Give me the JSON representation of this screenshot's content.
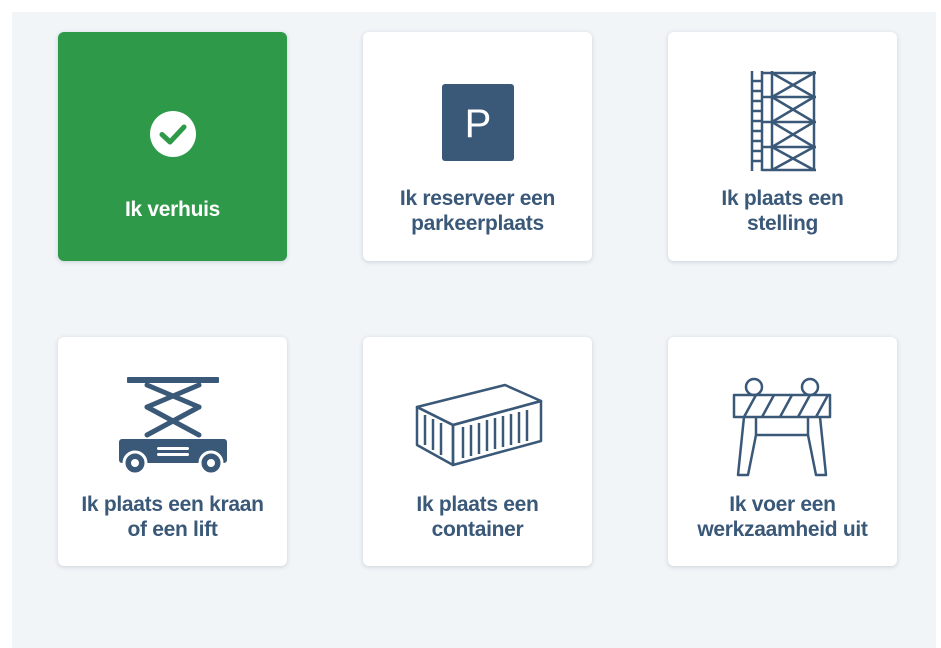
{
  "cards": [
    {
      "label_line1": "Ik verhuis",
      "label_line2": "",
      "icon": "check-circle-icon",
      "selected": true
    },
    {
      "label_line1": "Ik reserveer een",
      "label_line2": "parkeerplaats",
      "icon": "parking-icon",
      "icon_text": "P",
      "selected": false
    },
    {
      "label_line1": "Ik plaats een",
      "label_line2": "stelling",
      "icon": "scaffolding-icon",
      "selected": false
    },
    {
      "label_line1": "Ik plaats een kraan",
      "label_line2": "of een lift",
      "icon": "scissor-lift-icon",
      "selected": false
    },
    {
      "label_line1": "Ik plaats een",
      "label_line2": "container",
      "icon": "container-icon",
      "selected": false
    },
    {
      "label_line1": "Ik voer een",
      "label_line2": "werkzaamheid uit",
      "icon": "road-barrier-icon",
      "selected": false
    }
  ],
  "colors": {
    "selected_bg": "#2e9a49",
    "icon_navy": "#3a5878",
    "panel_bg": "#f1f5f8"
  }
}
